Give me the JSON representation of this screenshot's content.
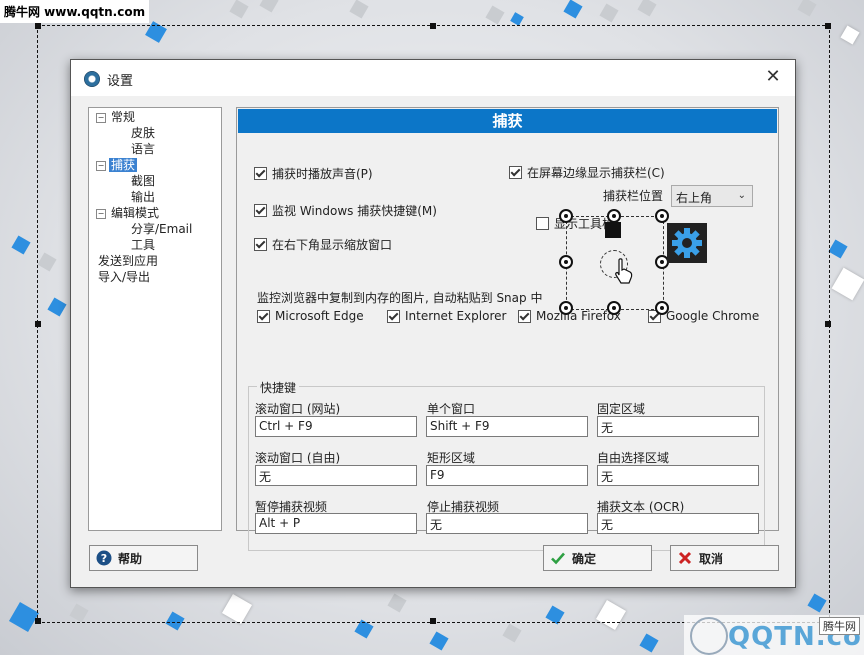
{
  "watermark_top": "腾牛网 www.qqtn.com",
  "watermark_bottom": {
    "logo": "QQTN.com",
    "badge": "腾牛网"
  },
  "window": {
    "title": "设置",
    "close_glyph": "✕"
  },
  "tree": {
    "nodes": [
      {
        "label": "常规"
      },
      {
        "label": "皮肤"
      },
      {
        "label": "语言"
      },
      {
        "label": "捕获"
      },
      {
        "label": "截图"
      },
      {
        "label": "输出"
      },
      {
        "label": "编辑模式"
      },
      {
        "label": "分享/Email"
      },
      {
        "label": "工具"
      },
      {
        "label": "发送到应用"
      },
      {
        "label": "导入/导出"
      }
    ],
    "selected_index": 3
  },
  "panel": {
    "title": "捕获",
    "options": {
      "play_sound": {
        "label": "捕获时播放声音(P)",
        "checked": true
      },
      "monitor_hotkeys": {
        "label": "监视 Windows 捕获快捷键(M)",
        "checked": true
      },
      "show_zoom": {
        "label": "在右下角显示缩放窗口",
        "checked": true
      },
      "edge_bar": {
        "label": "在屏幕边缘显示捕获栏(C)",
        "checked": true
      },
      "toolbar_hint": {
        "label": "显示工具栏",
        "checked": false
      }
    },
    "bar_position": {
      "label": "捕获栏位置",
      "value": "右上角",
      "arrow": "⌄"
    },
    "browser_monitor": {
      "label": "监控浏览器中复制到内存的图片, 自动粘贴到 Snap 中",
      "browsers": [
        {
          "label": "Microsoft Edge",
          "checked": true
        },
        {
          "label": "Internet Explorer",
          "checked": true
        },
        {
          "label": "Mozilla Firefox",
          "checked": true
        },
        {
          "label": "Google Chrome",
          "checked": true
        }
      ]
    },
    "hotkeys": {
      "group_label": "快捷键",
      "items": [
        {
          "label": "滚动窗口 (网站)",
          "value": "Ctrl + F9"
        },
        {
          "label": "单个窗口",
          "value": "Shift + F9"
        },
        {
          "label": "固定区域",
          "value": "无"
        },
        {
          "label": "滚动窗口 (自由)",
          "value": "无"
        },
        {
          "label": "矩形区域",
          "value": "F9"
        },
        {
          "label": "自由选择区域",
          "value": "无"
        },
        {
          "label": "暂停捕获视频",
          "value": "Alt + P"
        },
        {
          "label": "停止捕获视频",
          "value": "无"
        },
        {
          "label": "捕获文本 (OCR)",
          "value": "无"
        }
      ]
    }
  },
  "buttons": {
    "help": "帮助",
    "ok": "确定",
    "cancel": "取消"
  },
  "colors": {
    "accent": "#0c76c8",
    "selection": "#3b82d1",
    "ok_check": "#2ea043",
    "cancel_x": "#cc2222"
  },
  "icons": [
    "app-icon",
    "close-icon",
    "gear-icon",
    "help-icon",
    "check-icon",
    "cancel-icon",
    "cursor-icon"
  ]
}
